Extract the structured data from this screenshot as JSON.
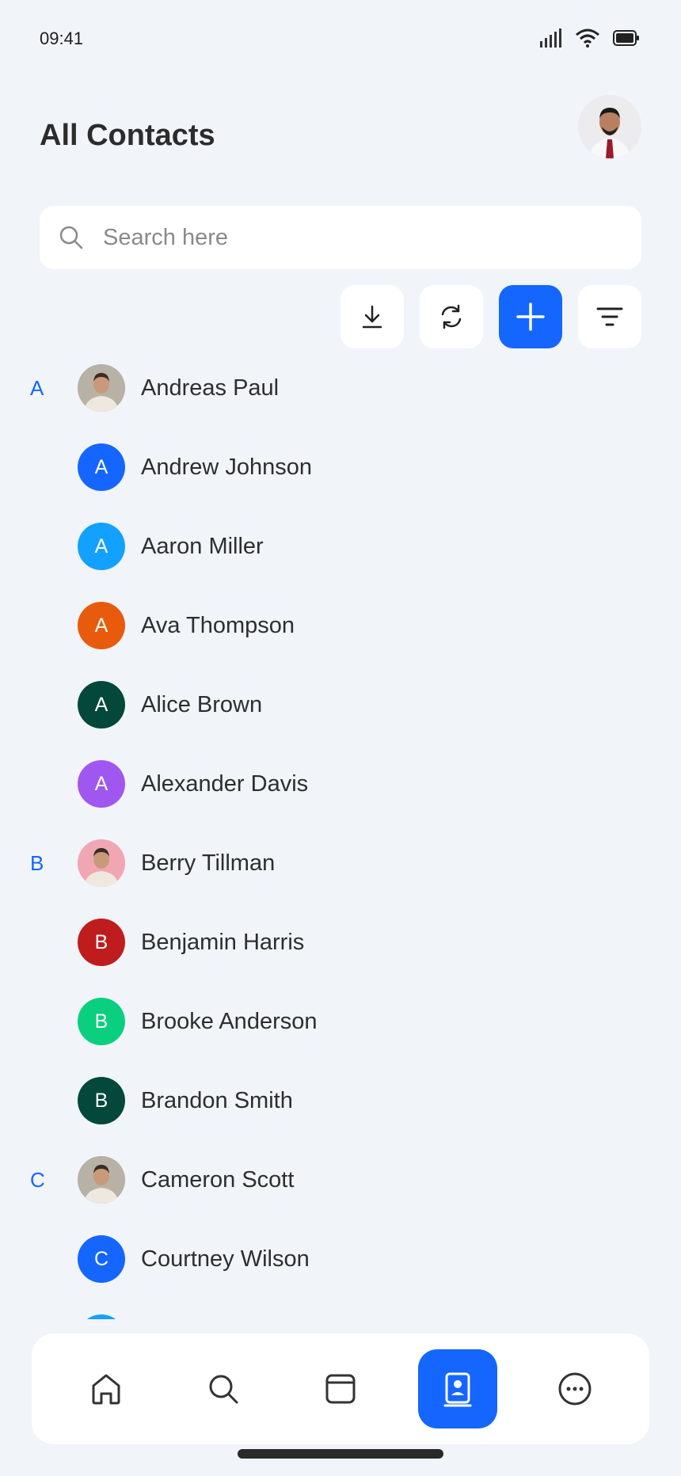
{
  "status": {
    "time": "09:41"
  },
  "header": {
    "title": "All Contacts"
  },
  "search": {
    "placeholder": "Search here",
    "value": ""
  },
  "theme": {
    "accent": "#1466FF",
    "background": "#F1F4F9"
  },
  "contacts": [
    {
      "section": "A",
      "name": "Andreas Paul",
      "initial": "",
      "avatar_type": "photo",
      "color": "#B8B1A6"
    },
    {
      "section": "",
      "name": "Andrew Johnson",
      "initial": "A",
      "avatar_type": "initial",
      "color": "#1466FF"
    },
    {
      "section": "",
      "name": "Aaron Miller",
      "initial": "A",
      "avatar_type": "initial",
      "color": "#13A1FF"
    },
    {
      "section": "",
      "name": "Ava Thompson",
      "initial": "A",
      "avatar_type": "initial",
      "color": "#E85A0C"
    },
    {
      "section": "",
      "name": "Alice Brown",
      "initial": "A",
      "avatar_type": "initial",
      "color": "#03483A"
    },
    {
      "section": "",
      "name": "Alexander Davis",
      "initial": "A",
      "avatar_type": "initial",
      "color": "#A057F0"
    },
    {
      "section": "B",
      "name": "Berry Tillman",
      "initial": "",
      "avatar_type": "photo",
      "color": "#F1A7B3"
    },
    {
      "section": "",
      "name": "Benjamin Harris",
      "initial": "B",
      "avatar_type": "initial",
      "color": "#BF1D1D"
    },
    {
      "section": "",
      "name": "Brooke Anderson",
      "initial": "B",
      "avatar_type": "initial",
      "color": "#0ACF7F"
    },
    {
      "section": "",
      "name": "Brandon Smith",
      "initial": "B",
      "avatar_type": "initial",
      "color": "#03483A"
    },
    {
      "section": "C",
      "name": "Cameron Scott",
      "initial": "",
      "avatar_type": "photo",
      "color": "#B8B1A6"
    },
    {
      "section": "",
      "name": "Courtney Wilson",
      "initial": "C",
      "avatar_type": "initial",
      "color": "#1466FF"
    },
    {
      "section": "",
      "name": "",
      "initial": "",
      "avatar_type": "initial",
      "color": "#13A1FF"
    }
  ],
  "actions": [
    {
      "name": "download-button",
      "icon": "download-icon"
    },
    {
      "name": "sync-button",
      "icon": "sync-icon"
    },
    {
      "name": "add-contact-button",
      "icon": "plus-icon"
    },
    {
      "name": "filter-button",
      "icon": "filter-icon"
    }
  ],
  "nav": [
    {
      "name": "nav-home",
      "icon": "home-icon",
      "active": false
    },
    {
      "name": "nav-search",
      "icon": "search-icon",
      "active": false
    },
    {
      "name": "nav-calendar",
      "icon": "calendar-icon",
      "active": false
    },
    {
      "name": "nav-contacts",
      "icon": "contacts-icon",
      "active": true
    },
    {
      "name": "nav-more",
      "icon": "more-icon",
      "active": false
    }
  ]
}
